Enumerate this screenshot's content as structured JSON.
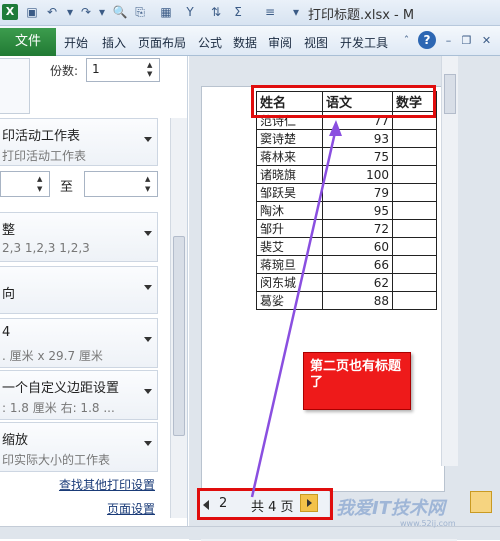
{
  "window": {
    "title": "打印标题.xlsx - M",
    "quick_access": [
      "save-icon",
      "undo-icon",
      "redo-icon",
      "print-preview-icon",
      "format-icon",
      "table-icon",
      "filter-icon",
      "sum-icon",
      "align-icon",
      "more-icon"
    ]
  },
  "ribbon": {
    "file_tab": "文件",
    "tabs": [
      "开始",
      "插入",
      "页面布局",
      "公式",
      "数据",
      "审阅",
      "视图",
      "开发工具"
    ]
  },
  "settings": {
    "copies_label": "份数:",
    "copies_value": "1",
    "print_what": {
      "line1": "印活动工作表",
      "line2": "打印活动工作表"
    },
    "pages_to": "至",
    "collate": {
      "line1": "整",
      "line2": "2,3    1,2,3    1,2,3"
    },
    "orientation": {
      "line1": "向"
    },
    "paper": {
      "line1": "4",
      "line2": ". 厘米 x 29.7 厘米"
    },
    "margins": {
      "line1": "一个自定义边距设置",
      "line2": ":  1.8 厘米    右:  1.8 ..."
    },
    "scaling": {
      "line1": "缩放",
      "line2": "印实际大小的工作表"
    },
    "link_more": "查找其他打印设置",
    "link_page_setup": "页面设置"
  },
  "preview": {
    "headers": [
      "姓名",
      "语文",
      "数学"
    ],
    "rows": [
      [
        "范诗仁",
        "77"
      ],
      [
        "窦诗楚",
        "93"
      ],
      [
        "蒋林来",
        "75"
      ],
      [
        "诸晓旗",
        "100"
      ],
      [
        "邹跃昊",
        "79"
      ],
      [
        "陶沐",
        "95"
      ],
      [
        "邹升",
        "72"
      ],
      [
        "裴艾",
        "60"
      ],
      [
        "蒋琬旦",
        "66"
      ],
      [
        "闵东城",
        "62"
      ],
      [
        "葛娑",
        "88"
      ]
    ]
  },
  "pager": {
    "current": "2",
    "total": "共 4 页"
  },
  "annotation": {
    "callout_text": "第二页也有标题了"
  },
  "watermark": {
    "text": "我爱IT技术网",
    "sub": "www.52ij.com"
  },
  "colors": {
    "accent_red": "#e00d0d",
    "file_tab": "#217a34",
    "callout_bg": "#ee1a1a",
    "arrow": "#8a4fe0"
  }
}
